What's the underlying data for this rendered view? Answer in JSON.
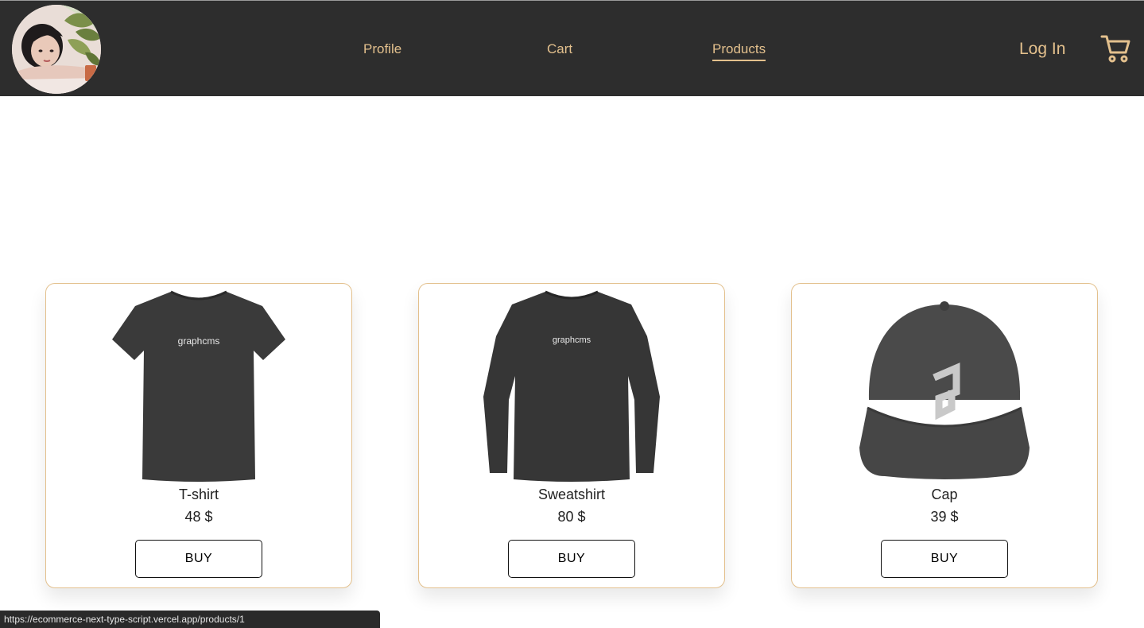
{
  "colors": {
    "topbar": "#2d2d2d",
    "accent": "#e3c08d",
    "card_border": "#e3c08d"
  },
  "nav": {
    "avatar_icon": "avatar-portrait",
    "links": [
      {
        "label": "Profile"
      },
      {
        "label": "Cart"
      },
      {
        "label": "Products",
        "active": true
      }
    ],
    "login_label": "Log In",
    "cart_icon": "shopping-cart-icon"
  },
  "products": [
    {
      "name": "T-shirt",
      "price": "48 $",
      "buy_label": "BUY",
      "icon": "tshirt-image"
    },
    {
      "name": "Sweatshirt",
      "price": "80 $",
      "buy_label": "BUY",
      "icon": "sweatshirt-image"
    },
    {
      "name": "Cap",
      "price": "39 $",
      "buy_label": "BUY",
      "icon": "cap-image"
    }
  ],
  "status_url": "https://ecommerce-next-type-script.vercel.app/products/1"
}
